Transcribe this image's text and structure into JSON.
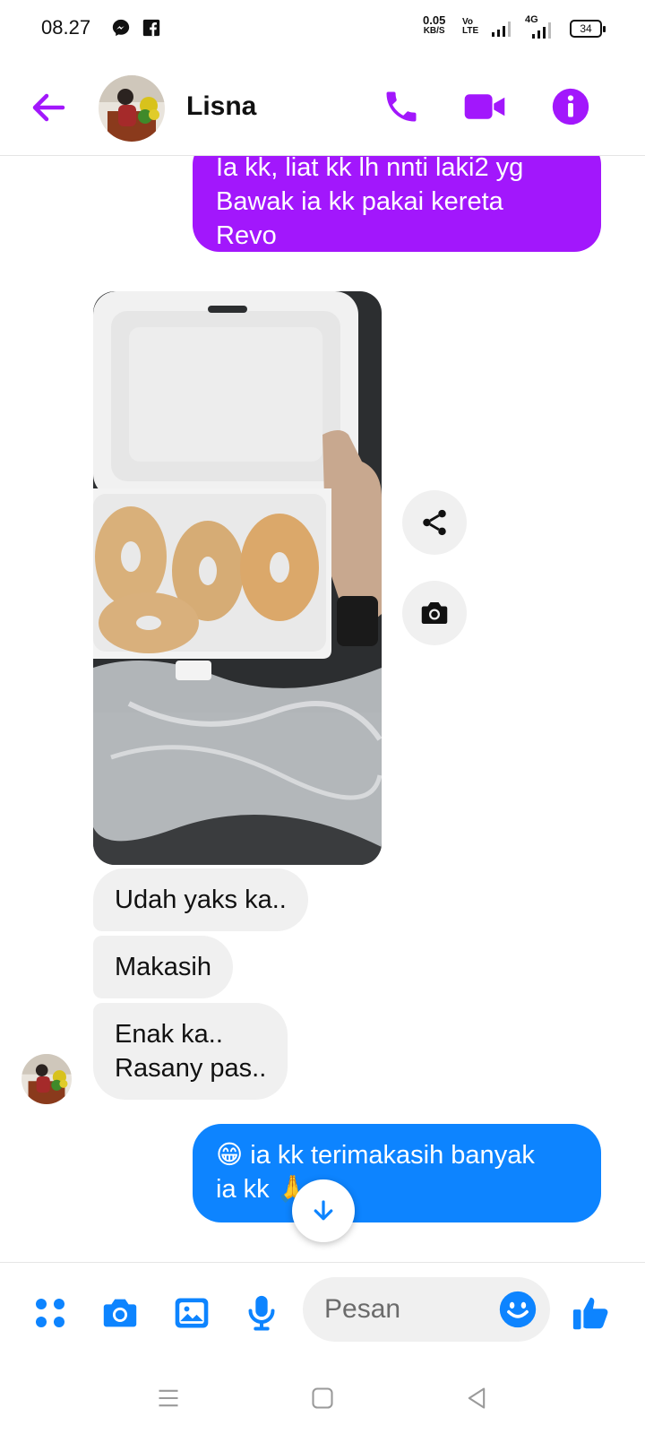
{
  "status_bar": {
    "time": "08.27",
    "net_speed_value": "0.05",
    "net_speed_unit": "KB/S",
    "volte_top": "Vo",
    "volte_bottom": "LTE",
    "network": "4G",
    "battery": "34",
    "icons": [
      "messenger-icon",
      "facebook-icon",
      "signal-icon",
      "signal-4g-icon",
      "battery-icon"
    ]
  },
  "header": {
    "contact_name": "Lisna",
    "icons": [
      "back-arrow-icon",
      "phone-icon",
      "video-camera-icon",
      "info-icon"
    ],
    "accent_color": "#a217fc"
  },
  "messages": [
    {
      "direction": "outgoing",
      "text_lines": [
        "Ia kk, liat kk lh nnti laki2 yg",
        "Bawak ia kk pakai kereta",
        "Revo"
      ],
      "color": "#a217fc"
    },
    {
      "direction": "incoming",
      "type": "photo",
      "actions": [
        "share-icon",
        "camera-icon"
      ]
    },
    {
      "direction": "incoming",
      "text": "Udah yaks ka.."
    },
    {
      "direction": "incoming",
      "text": "Makasih"
    },
    {
      "direction": "incoming",
      "text_lines": [
        "Enak ka..",
        "Rasany pas.."
      ]
    },
    {
      "direction": "outgoing",
      "text_lines": [
        "😁 ia kk terimakasih banyak",
        "ia kk 🙏"
      ],
      "color": "#0d84ff"
    }
  ],
  "composer": {
    "placeholder": "Pesan",
    "icons": [
      "apps-icon",
      "camera-icon",
      "gallery-icon",
      "microphone-icon",
      "emoji-icon",
      "thumbs-up-icon"
    ],
    "accent_color": "#0d84ff"
  },
  "nav_bar": {
    "icons": [
      "menu-icon",
      "home-icon",
      "back-icon"
    ]
  }
}
